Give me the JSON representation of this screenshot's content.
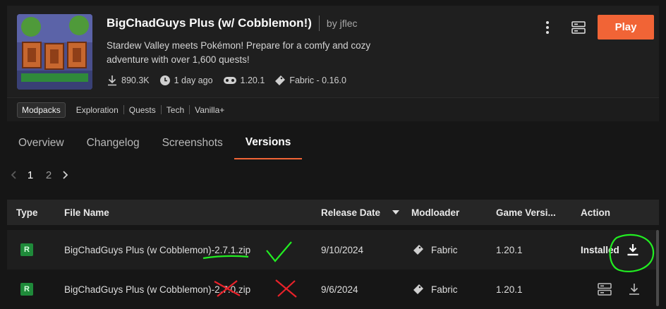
{
  "header": {
    "title": "BigChadGuys Plus (w/ Cobblemon!)",
    "author": "by jflec",
    "description": "Stardew Valley meets Pokémon! Prepare for a comfy and cozy adventure with over 1,600 quests!",
    "stats": {
      "downloads": "890.3K",
      "updated": "1 day ago",
      "game_version": "1.20.1",
      "loader": "Fabric - 0.16.0"
    },
    "play_label": "Play",
    "accent": "#f16436"
  },
  "tags": [
    "Modpacks",
    "Exploration",
    "Quests",
    "Tech",
    "Vanilla+"
  ],
  "tabs": [
    "Overview",
    "Changelog",
    "Screenshots",
    "Versions"
  ],
  "active_tab": "Versions",
  "pagination": {
    "pages": [
      "1",
      "2"
    ],
    "current": "1"
  },
  "table": {
    "headers": [
      "Type",
      "File Name",
      "Release Date",
      "Modloader",
      "Game Versi...",
      "Action"
    ],
    "rows": [
      {
        "type": "R",
        "file": "BigChadGuys Plus (w Cobblemon)-2.7.1.zip",
        "date": "9/10/2024",
        "loader": "Fabric",
        "version": "1.20.1",
        "action": "Installed"
      },
      {
        "type": "R",
        "file": "BigChadGuys Plus (w Cobblemon)-2.7.0.zip",
        "date": "9/6/2024",
        "loader": "Fabric",
        "version": "1.20.1",
        "action": ""
      }
    ]
  }
}
